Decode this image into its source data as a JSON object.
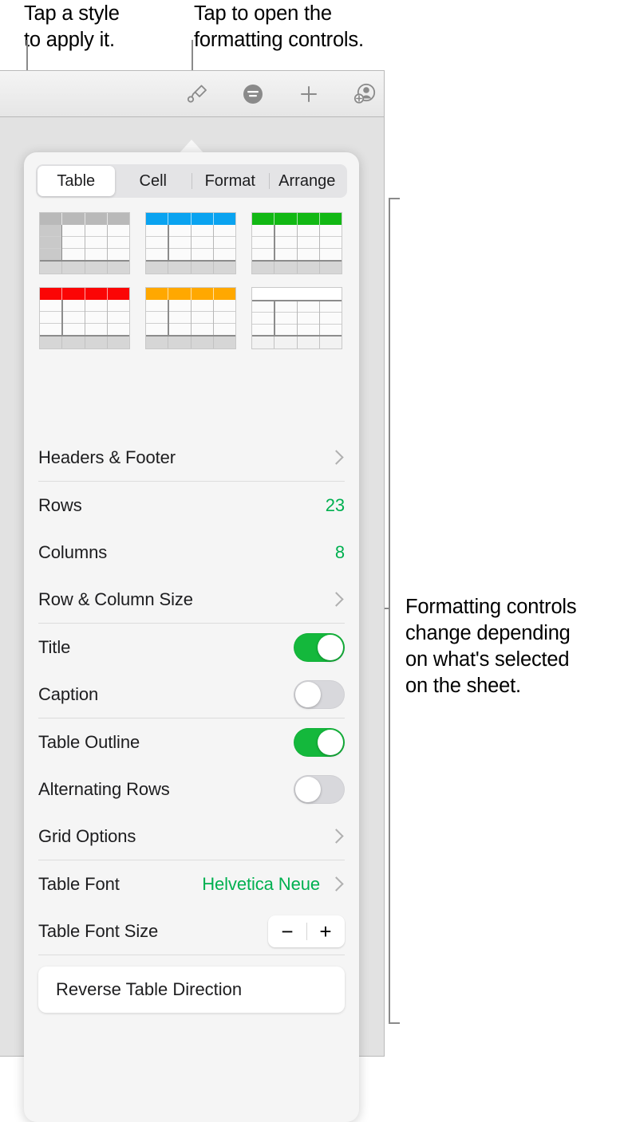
{
  "callouts": {
    "style": "Tap a style\nto apply it.",
    "format": "Tap to open the\nformatting controls.",
    "controls": "Formatting controls\nchange depending\non what's selected\non the sheet."
  },
  "toolbar": {
    "icons": [
      {
        "name": "paintbrush-icon",
        "label": "Format"
      },
      {
        "name": "insert-icon",
        "label": "Insert"
      },
      {
        "name": "plus-icon",
        "label": "Add"
      },
      {
        "name": "collaborate-icon",
        "label": "Collaborate"
      }
    ]
  },
  "popover": {
    "tabs": [
      {
        "label": "Table",
        "active": true
      },
      {
        "label": "Cell",
        "active": false
      },
      {
        "label": "Format",
        "active": false
      },
      {
        "label": "Arrange",
        "active": false
      }
    ],
    "styles": [
      {
        "name": "table-style-gray",
        "header_color": "#b9b9b9",
        "selected": true
      },
      {
        "name": "table-style-blue",
        "header_color": "#0aa3f0",
        "selected": false
      },
      {
        "name": "table-style-green",
        "header_color": "#12b814",
        "selected": false
      },
      {
        "name": "table-style-red",
        "header_color": "#fb0505",
        "selected": false
      },
      {
        "name": "table-style-orange",
        "header_color": "#ffa800",
        "selected": false
      },
      {
        "name": "table-style-plain",
        "header_color": "#ffffff",
        "selected": false
      }
    ],
    "rows": [
      {
        "name": "headers-and-footer",
        "label": "Headers & Footer",
        "control": "chevron"
      },
      {
        "name": "rows",
        "label": "Rows",
        "value": "23",
        "control": "value"
      },
      {
        "name": "columns",
        "label": "Columns",
        "value": "8",
        "control": "value"
      },
      {
        "name": "row-and-column-size",
        "label": "Row & Column Size",
        "control": "chevron"
      },
      {
        "name": "title",
        "label": "Title",
        "control": "toggle",
        "on": true
      },
      {
        "name": "caption",
        "label": "Caption",
        "control": "toggle",
        "on": false
      },
      {
        "name": "table-outline",
        "label": "Table Outline",
        "control": "toggle",
        "on": true
      },
      {
        "name": "alternating-rows",
        "label": "Alternating Rows",
        "control": "toggle",
        "on": false
      },
      {
        "name": "grid-options",
        "label": "Grid Options",
        "control": "chevron"
      },
      {
        "name": "table-font",
        "label": "Table Font",
        "value": "Helvetica Neue",
        "control": "value-chevron"
      },
      {
        "name": "table-font-size",
        "label": "Table Font Size",
        "control": "stepper",
        "minus": "−",
        "plus": "+"
      }
    ],
    "reverse_button": "Reverse Table Direction"
  },
  "colors": {
    "accent_green": "#00b050",
    "toggle_on": "#14b83c",
    "toggle_off": "#d8d8dc",
    "panel_bg": "#f5f5f5",
    "leader": "#8a8a8a"
  }
}
